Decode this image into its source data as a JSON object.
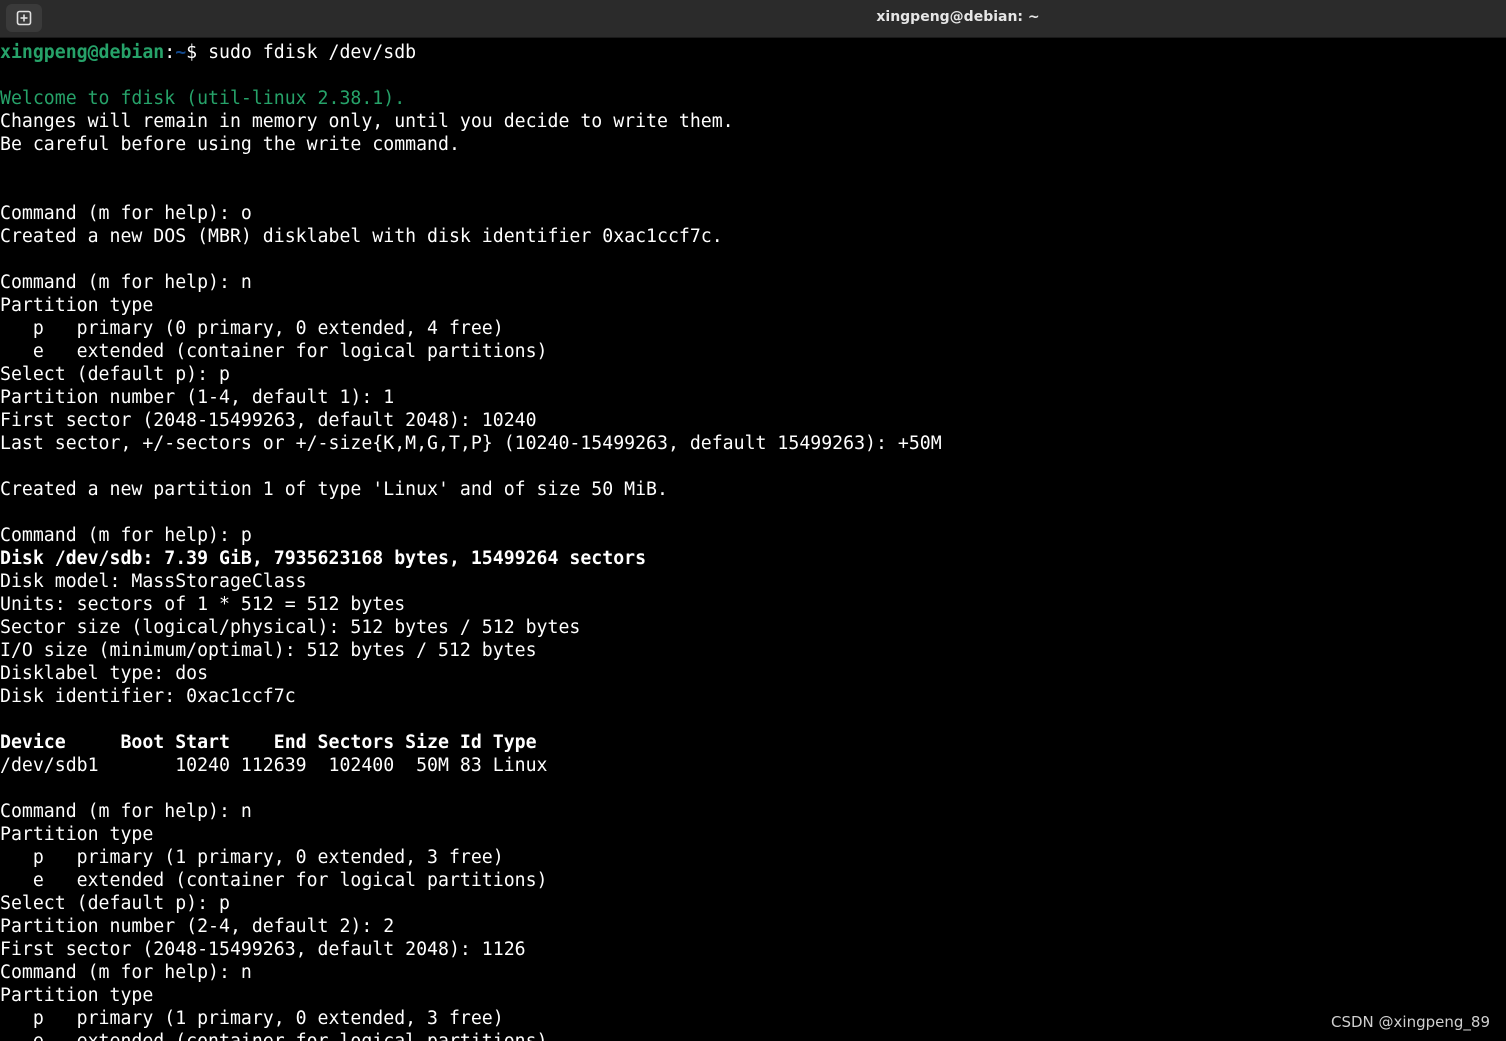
{
  "window": {
    "title": "xingpeng@debian: ~"
  },
  "icons": {
    "new_tab": "new-tab-icon"
  },
  "colors": {
    "background": "#000000",
    "titlebar": "#2b2b2b",
    "prompt_user": "#26a269",
    "prompt_path": "#12488b",
    "welcome": "#26a269",
    "text": "#ffffff"
  },
  "terminal": {
    "prompt_user": "xingpeng@debian",
    "prompt_colon": ":",
    "prompt_path": "~",
    "prompt_symbol": "$ ",
    "command": "sudo fdisk /dev/sdb",
    "lines": [
      {
        "text": "",
        "style": "plain"
      },
      {
        "text": "Welcome to fdisk (util-linux 2.38.1).",
        "style": "green"
      },
      {
        "text": "Changes will remain in memory only, until you decide to write them.",
        "style": "plain"
      },
      {
        "text": "Be careful before using the write command.",
        "style": "plain"
      },
      {
        "text": "",
        "style": "plain"
      },
      {
        "text": "",
        "style": "plain"
      },
      {
        "text": "Command (m for help): o",
        "style": "plain"
      },
      {
        "text": "Created a new DOS (MBR) disklabel with disk identifier 0xac1ccf7c.",
        "style": "plain"
      },
      {
        "text": "",
        "style": "plain"
      },
      {
        "text": "Command (m for help): n",
        "style": "plain"
      },
      {
        "text": "Partition type",
        "style": "plain"
      },
      {
        "text": "   p   primary (0 primary, 0 extended, 4 free)",
        "style": "plain"
      },
      {
        "text": "   e   extended (container for logical partitions)",
        "style": "plain"
      },
      {
        "text": "Select (default p): p",
        "style": "plain"
      },
      {
        "text": "Partition number (1-4, default 1): 1",
        "style": "plain"
      },
      {
        "text": "First sector (2048-15499263, default 2048): 10240",
        "style": "plain"
      },
      {
        "text": "Last sector, +/-sectors or +/-size{K,M,G,T,P} (10240-15499263, default 15499263): +50M",
        "style": "plain"
      },
      {
        "text": "",
        "style": "plain"
      },
      {
        "text": "Created a new partition 1 of type 'Linux' and of size 50 MiB.",
        "style": "plain"
      },
      {
        "text": "",
        "style": "plain"
      },
      {
        "text": "Command (m for help): p",
        "style": "plain"
      },
      {
        "text": "Disk /dev/sdb: 7.39 GiB, 7935623168 bytes, 15499264 sectors",
        "style": "bold"
      },
      {
        "text": "Disk model: MassStorageClass",
        "style": "plain"
      },
      {
        "text": "Units: sectors of 1 * 512 = 512 bytes",
        "style": "plain"
      },
      {
        "text": "Sector size (logical/physical): 512 bytes / 512 bytes",
        "style": "plain"
      },
      {
        "text": "I/O size (minimum/optimal): 512 bytes / 512 bytes",
        "style": "plain"
      },
      {
        "text": "Disklabel type: dos",
        "style": "plain"
      },
      {
        "text": "Disk identifier: 0xac1ccf7c",
        "style": "plain"
      },
      {
        "text": "",
        "style": "plain"
      },
      {
        "text": "Device     Boot Start    End Sectors Size Id Type",
        "style": "bold"
      },
      {
        "text": "/dev/sdb1       10240 112639  102400  50M 83 Linux",
        "style": "plain"
      },
      {
        "text": "",
        "style": "plain"
      },
      {
        "text": "Command (m for help): n",
        "style": "plain"
      },
      {
        "text": "Partition type",
        "style": "plain"
      },
      {
        "text": "   p   primary (1 primary, 0 extended, 3 free)",
        "style": "plain"
      },
      {
        "text": "   e   extended (container for logical partitions)",
        "style": "plain"
      },
      {
        "text": "Select (default p): p",
        "style": "plain"
      },
      {
        "text": "Partition number (2-4, default 2): 2",
        "style": "plain"
      },
      {
        "text": "First sector (2048-15499263, default 2048): 1126",
        "style": "plain"
      },
      {
        "text": "Command (m for help): n",
        "style": "plain"
      },
      {
        "text": "Partition type",
        "style": "plain"
      },
      {
        "text": "   p   primary (1 primary, 0 extended, 3 free)",
        "style": "plain"
      },
      {
        "text": "   e   extended (container for logical partitions)",
        "style": "plain"
      }
    ]
  },
  "watermark": "CSDN @xingpeng_89"
}
